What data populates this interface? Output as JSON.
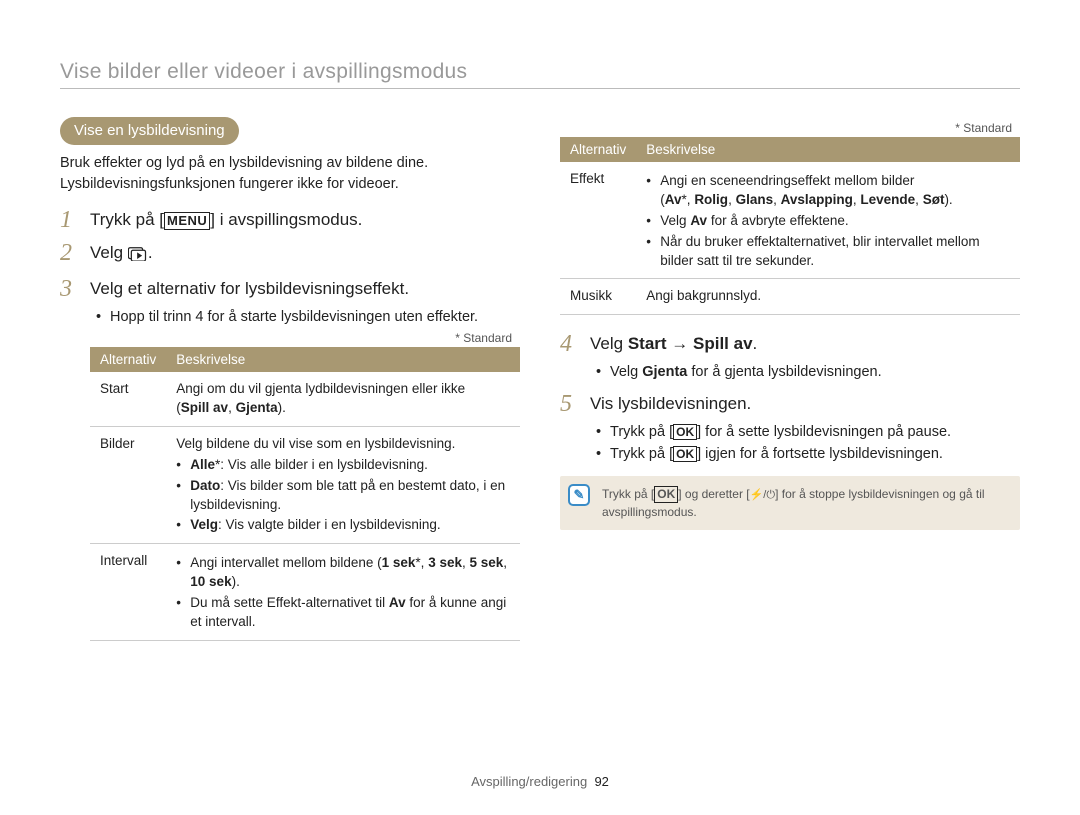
{
  "header": {
    "title": "Vise bilder eller videoer i avspillingsmodus"
  },
  "section": {
    "label": "Vise en lysbildevisning"
  },
  "intro": "Bruk effekter og lyd på en lysbildevisning av bildene dine. Lysbildevisningsfunksjonen fungerer ikke for videoer.",
  "steps": {
    "s1_a": "Trykk på [",
    "s1_b": "] i avspillingsmodus.",
    "s2_a": "Velg ",
    "s2_b": ".",
    "s3": "Velg et alternativ for lysbildevisningseffekt.",
    "s3_note": "Hopp til trinn 4 for å starte lysbildevisningen uten effekter.",
    "s4_a": "Velg ",
    "s4_b": "Start",
    "s4_c": " → ",
    "s4_d": "Spill av",
    "s4_e": ".",
    "s4_note_a": "Velg ",
    "s4_note_b": "Gjenta",
    "s4_note_c": " for å gjenta lysbildevisningen.",
    "s5": "Vis lysbildevisningen.",
    "s5_n1_a": "Trykk på [",
    "s5_n1_b": "] for å sette lysbildevisningen på pause.",
    "s5_n2_a": "Trykk på [",
    "s5_n2_b": "] igjen for å fortsette lysbildevisningen."
  },
  "standard": "* Standard",
  "tables": {
    "head_opt": "Alternativ",
    "head_desc": "Beskrivelse",
    "left": {
      "start": {
        "key": "Start",
        "line1": "Angi om du vil gjenta lydbildevisningen eller ikke",
        "line2a": "(",
        "line2b": "Spill av",
        "line2c": ", ",
        "line2d": "Gjenta",
        "line2e": ")."
      },
      "bilder": {
        "key": "Bilder",
        "intro": "Velg bildene du vil vise som en lysbildevisning.",
        "b1a": "Alle",
        "b1b": "*: Vis alle bilder i en lysbildevisning.",
        "b2a": "Dato",
        "b2b": ": Vis bilder som ble tatt på en bestemt dato, i en lysbildevisning.",
        "b3a": "Velg",
        "b3b": ": Vis valgte bilder i en lysbildevisning."
      },
      "intervall": {
        "key": "Intervall",
        "b1a": "Angi intervallet mellom bildene (",
        "b1b": "1 sek",
        "b1c": "*, ",
        "b1d": "3 sek",
        "b1e": ", ",
        "b1f": "5 sek",
        "b1g": ", ",
        "b1h": "10 sek",
        "b1i": ").",
        "b2a": "Du må sette Effekt-alternativet til ",
        "b2b": "Av",
        "b2c": " for å kunne angi et intervall."
      }
    },
    "right": {
      "effekt": {
        "key": "Effekt",
        "b1": "Angi en sceneendringseffekt mellom bilder",
        "b1b_a": "(",
        "b1b_b": "Av",
        "b1b_c": "*, ",
        "b1b_d": "Rolig",
        "b1b_e": ", ",
        "b1b_f": "Glans",
        "b1b_g": ", ",
        "b1b_h": "Avslapping",
        "b1b_i": ", ",
        "b1b_j": "Levende",
        "b1b_k": ", ",
        "b1b_l": "Søt",
        "b1b_m": ").",
        "b2a": "Velg ",
        "b2b": "Av",
        "b2c": " for å avbryte effektene.",
        "b3": "Når du bruker effektalternativet, blir intervallet mellom bilder satt til tre sekunder."
      },
      "musikk": {
        "key": "Musikk",
        "val": "Angi bakgrunnslyd."
      }
    }
  },
  "note": {
    "a": "Trykk på [",
    "b": "] og deretter [",
    "c": "] for å stoppe lysbildevisningen og gå til avspillingsmodus."
  },
  "icons": {
    "menu": "MENU",
    "ok": "OK"
  },
  "footer": {
    "section": "Avspilling/redigering",
    "page": "92"
  }
}
